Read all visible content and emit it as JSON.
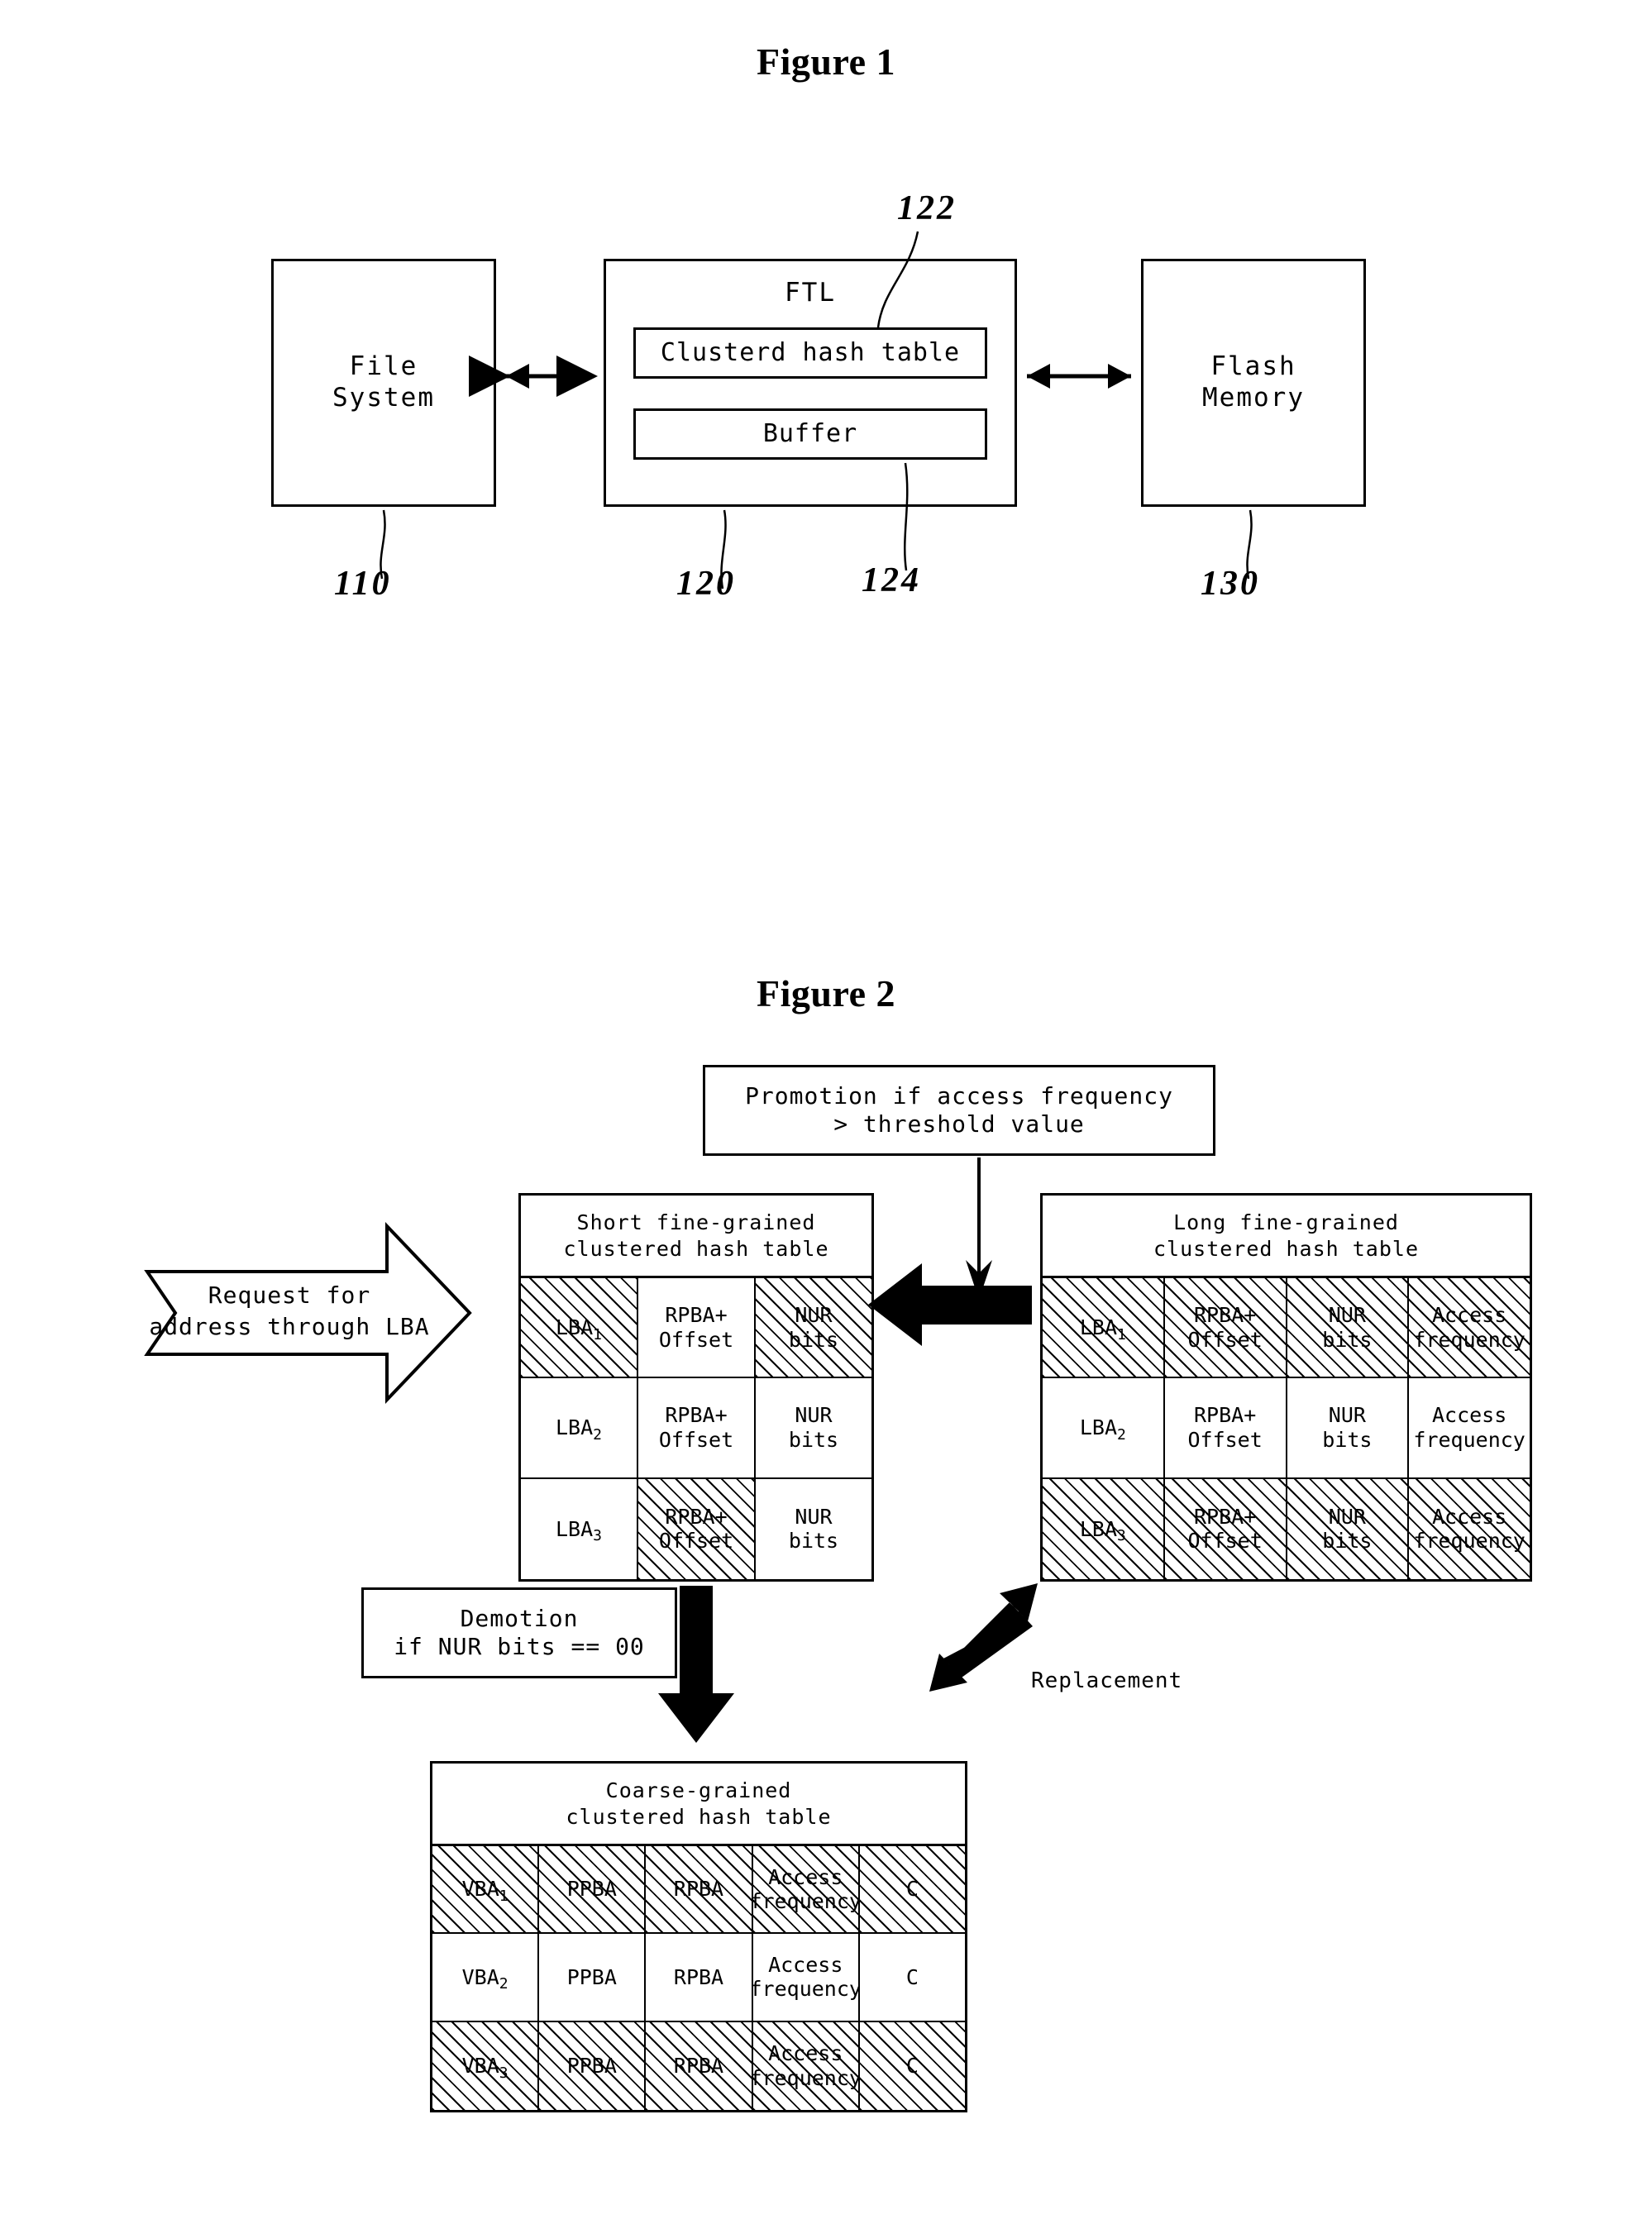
{
  "figure1": {
    "title": "Figure 1",
    "blocks": [
      {
        "label": "File\nSystem",
        "ref": "110"
      },
      {
        "label": "FTL",
        "ref": "120"
      },
      {
        "label": "Flash\nMemory",
        "ref": "130"
      }
    ],
    "file_system_line1": "File",
    "file_system_line2": "System",
    "ftl_label": "FTL",
    "ftl_inner": [
      {
        "label": "Clusterd hash table",
        "ref": "122"
      },
      {
        "label": "Buffer",
        "ref": "124"
      }
    ],
    "flash_line1": "Flash",
    "flash_line2": "Memory",
    "refs": {
      "file_system": "110",
      "ftl": "120",
      "buffer": "124",
      "flash": "130",
      "hash_table": "122"
    }
  },
  "figure2": {
    "title": "Figure 2",
    "promotion_box": {
      "line1": "Promotion if access frequency",
      "line2": "> threshold value"
    },
    "demotion_box": {
      "line1": "Demotion",
      "line2": "if NUR bits == 00"
    },
    "replacement_label": "Replacement",
    "request_arrow": {
      "line1": "Request for",
      "line2": "address through LBA"
    },
    "short_table": {
      "title_line1": "Short fine-grained",
      "title_line2": "clustered hash table",
      "rows": [
        {
          "cells": [
            {
              "text": "LBA",
              "sub": "1",
              "hatched": true
            },
            {
              "text": "RPBA+\nOffset",
              "hatched": false
            },
            {
              "text": "NUR\nbits",
              "hatched": true
            }
          ]
        },
        {
          "cells": [
            {
              "text": "LBA",
              "sub": "2",
              "hatched": false
            },
            {
              "text": "RPBA+\nOffset",
              "hatched": false
            },
            {
              "text": "NUR\nbits",
              "hatched": false
            }
          ]
        },
        {
          "cells": [
            {
              "text": "LBA",
              "sub": "3",
              "hatched": false
            },
            {
              "text": "RPBA+\nOffset",
              "hatched": true
            },
            {
              "text": "NUR\nbits",
              "hatched": false
            }
          ]
        }
      ]
    },
    "long_table": {
      "title_line1": "Long fine-grained",
      "title_line2": "clustered hash table",
      "rows": [
        {
          "cells": [
            {
              "text": "LBA",
              "sub": "1",
              "hatched": true
            },
            {
              "text": "RPBA+\nOffset",
              "hatched": true
            },
            {
              "text": "NUR\nbits",
              "hatched": true
            },
            {
              "text": "Access\nfrequency",
              "hatched": true
            }
          ]
        },
        {
          "cells": [
            {
              "text": "LBA",
              "sub": "2",
              "hatched": false
            },
            {
              "text": "RPBA+\nOffset",
              "hatched": false
            },
            {
              "text": "NUR\nbits",
              "hatched": false
            },
            {
              "text": "Access\nfrequency",
              "hatched": false
            }
          ]
        },
        {
          "cells": [
            {
              "text": "LBA",
              "sub": "3",
              "hatched": true
            },
            {
              "text": "RPBA+\nOffset",
              "hatched": true
            },
            {
              "text": "NUR\nbits",
              "hatched": true
            },
            {
              "text": "Access\nfrequency",
              "hatched": true
            }
          ]
        }
      ]
    },
    "coarse_table": {
      "title_line1": "Coarse-grained",
      "title_line2": "clustered hash table",
      "rows": [
        {
          "cells": [
            {
              "text": "VBA",
              "sub": "1",
              "hatched": true
            },
            {
              "text": "PPBA",
              "hatched": true
            },
            {
              "text": "RPBA",
              "hatched": true
            },
            {
              "text": "Access\nfrequency",
              "hatched": true
            },
            {
              "text": "C",
              "hatched": true
            }
          ]
        },
        {
          "cells": [
            {
              "text": "VBA",
              "sub": "2",
              "hatched": false
            },
            {
              "text": "PPBA",
              "hatched": false
            },
            {
              "text": "RPBA",
              "hatched": false
            },
            {
              "text": "Access\nfrequency",
              "hatched": false
            },
            {
              "text": "C",
              "hatched": false
            }
          ]
        },
        {
          "cells": [
            {
              "text": "VBA",
              "sub": "3",
              "hatched": true
            },
            {
              "text": "PPBA",
              "hatched": true
            },
            {
              "text": "RPBA",
              "hatched": true
            },
            {
              "text": "Access\nfrequency",
              "hatched": true
            },
            {
              "text": "C",
              "hatched": true
            }
          ]
        }
      ]
    }
  }
}
